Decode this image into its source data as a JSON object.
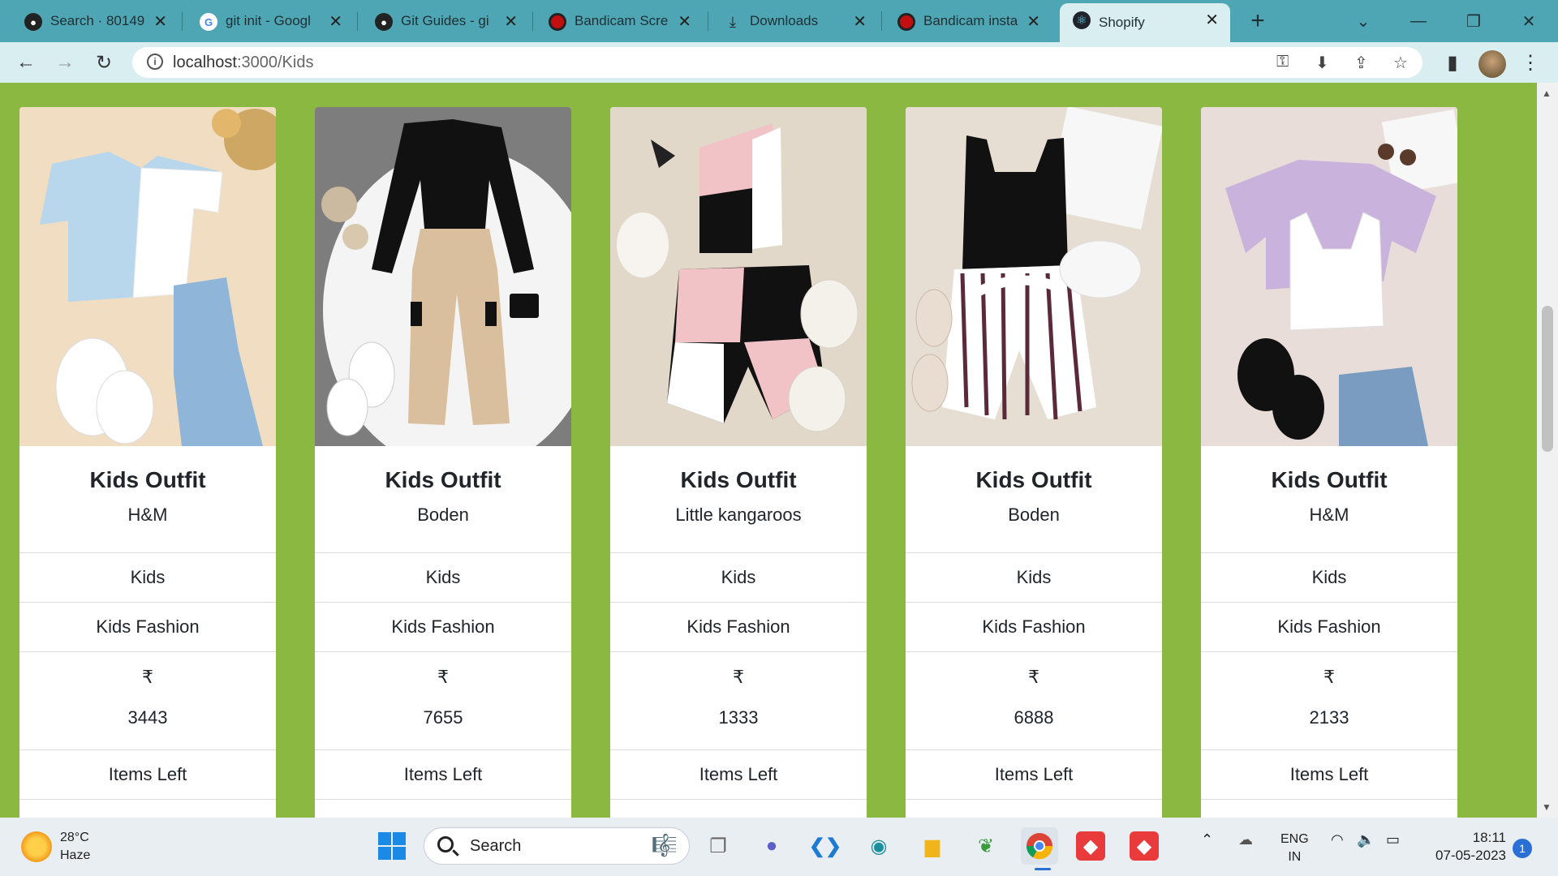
{
  "browser": {
    "tabs": [
      {
        "title": "Search · 80149",
        "icon": "github-icon"
      },
      {
        "title": "git init - Googl",
        "icon": "google-icon"
      },
      {
        "title": "Git Guides - gi",
        "icon": "github-icon"
      },
      {
        "title": "Bandicam Scre",
        "icon": "bandicam-icon"
      },
      {
        "title": "Downloads",
        "icon": "download-icon"
      },
      {
        "title": "Bandicam insta",
        "icon": "bandicam-icon"
      },
      {
        "title": "Shopify",
        "icon": "react-icon",
        "active": true
      }
    ],
    "url_host": "localhost",
    "url_path": ":3000/Kids"
  },
  "products": [
    {
      "title": "Kids Outfit",
      "brand": "H&M",
      "category": "Kids",
      "subcategory": "Kids Fashion",
      "currency": "₹",
      "price": "3443",
      "stock": "Items Left",
      "image": "light blue cardigan top, jeans and white sneakers"
    },
    {
      "title": "Kids Outfit",
      "brand": "Boden",
      "category": "Kids",
      "subcategory": "Kids Fashion",
      "currency": "₹",
      "price": "7655",
      "stock": "Items Left",
      "image": "black turtleneck with beige cargo pants"
    },
    {
      "title": "Kids Outfit",
      "brand": "Little kangaroos",
      "category": "Kids",
      "subcategory": "Kids Fashion",
      "currency": "₹",
      "price": "1333",
      "stock": "Items Left",
      "image": "pink and black colour-block crop top with shorts"
    },
    {
      "title": "Kids Outfit",
      "brand": "Boden",
      "category": "Kids",
      "subcategory": "Kids Fashion",
      "currency": "₹",
      "price": "6888",
      "stock": "Items Left",
      "image": "black tank top with striped shorts"
    },
    {
      "title": "Kids Outfit",
      "brand": "H&M",
      "category": "Kids",
      "subcategory": "Kids Fashion",
      "currency": "₹",
      "price": "2133",
      "stock": "Items Left",
      "image": "lilac tee with white tank top and denim shorts"
    }
  ],
  "taskbar": {
    "weather_temp": "28°C",
    "weather_desc": "Haze",
    "search_label": "Search",
    "lang_top": "ENG",
    "lang_bottom": "IN",
    "time": "18:11",
    "date": "07-05-2023",
    "notifications": "1"
  },
  "colors": {
    "page_bg": "#8ab840",
    "tabstrip": "#4ea6b4",
    "toolbar": "#d8eef1"
  }
}
